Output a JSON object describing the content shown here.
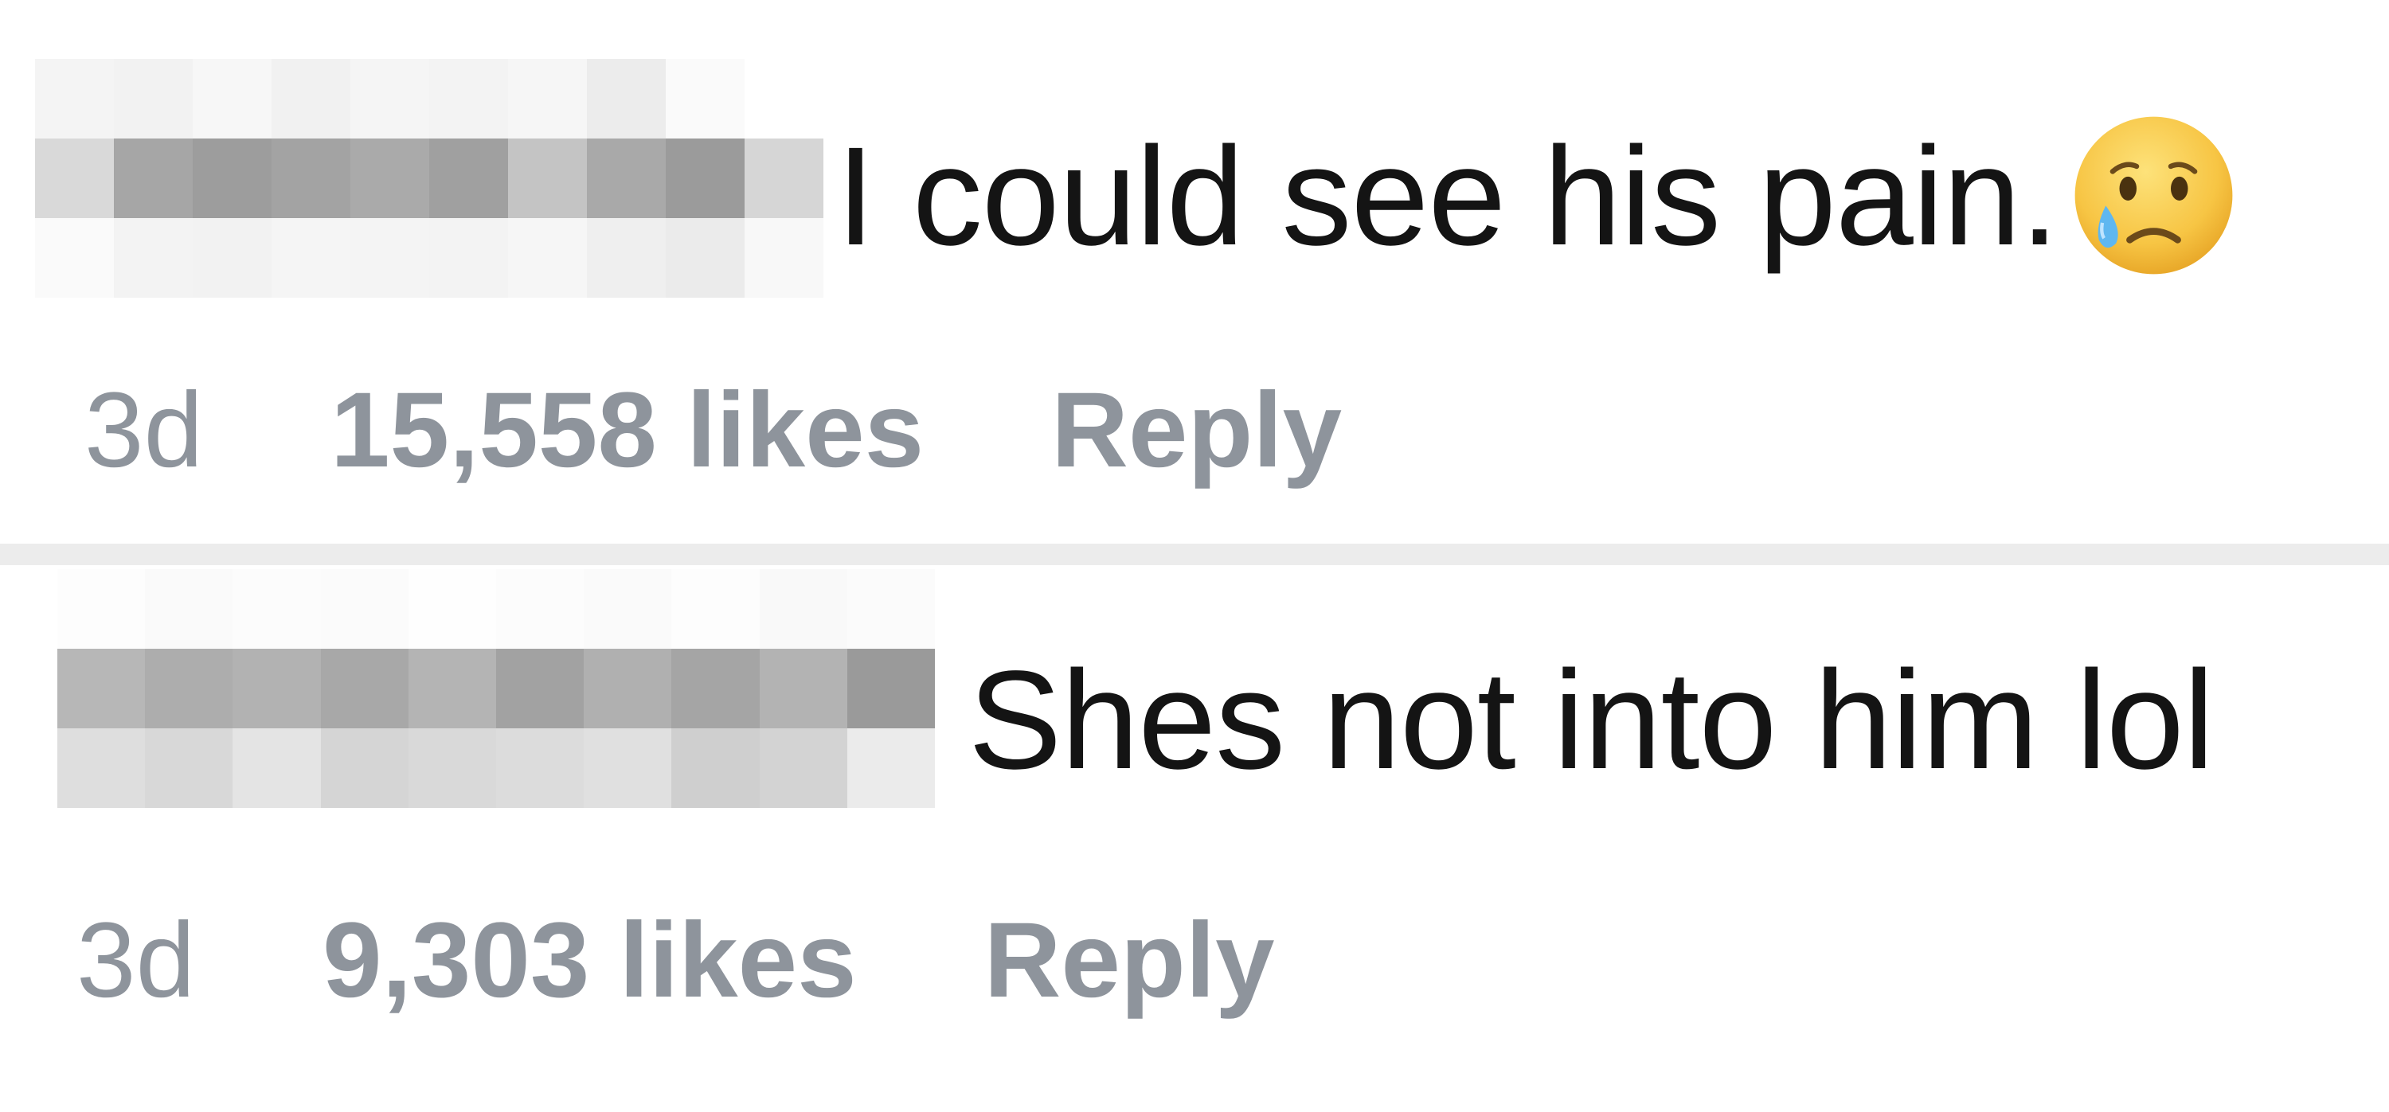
{
  "comments": [
    {
      "text": "I could see his pain.",
      "emoji": "crying-face-icon",
      "time": "3d",
      "likes": "15,558 likes",
      "reply": "Reply"
    },
    {
      "text": "Shes not into him lol",
      "time": "3d",
      "likes": "9,303 likes",
      "reply": "Reply"
    }
  ],
  "colors": {
    "text": "#141414",
    "meta": "#8e949c",
    "divider": "#ececec",
    "emoji_face": "#f7c544"
  }
}
